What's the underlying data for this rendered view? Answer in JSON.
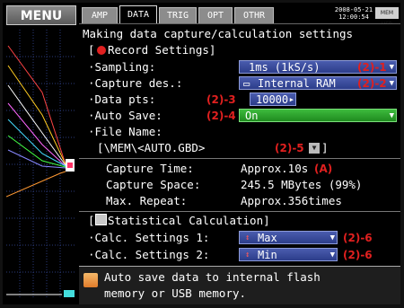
{
  "menu_button": "MENU",
  "tabs": [
    {
      "label": "AMP",
      "active": false
    },
    {
      "label": "DATA",
      "active": true
    },
    {
      "label": "TRIG",
      "active": false
    },
    {
      "label": "OPT",
      "active": false
    },
    {
      "label": "OTHR",
      "active": false
    }
  ],
  "status": {
    "date": "2008-05-21",
    "time": "12:00:54",
    "mem_badge": "MEM USB"
  },
  "heading": "Making data capture/calculation settings",
  "record_section": {
    "open_bracket": "[",
    "title": "Record Settings]",
    "items": [
      {
        "label": "·Sampling:",
        "value": "1ms (1kS/s)",
        "annotation": "(2)-1"
      },
      {
        "label": "·Capture des.:",
        "value": "Internal RAM",
        "annotation": "(2)-2"
      },
      {
        "label": "·Data pts:",
        "annotation": "(2)-3",
        "value": "10000"
      },
      {
        "label": "·Auto Save:",
        "annotation": "(2)-4",
        "value": "On"
      },
      {
        "label": "·File Name:"
      }
    ],
    "file_path": "[\\MEM\\<AUTO.GBD>",
    "file_path_annotation": "(2)-5",
    "file_path_close": "]"
  },
  "capture_info": {
    "capture_time_label": "Capture Time:",
    "capture_time_value": "Approx.10s",
    "capture_time_annotation": "(A)",
    "capture_space_label": "Capture Space:",
    "capture_space_value": "245.5 MBytes (99%)",
    "max_repeat_label": "Max. Repeat:",
    "max_repeat_value": "Approx.356times"
  },
  "stat_section": {
    "open_bracket": "[",
    "title": "Statistical Calculation]",
    "items": [
      {
        "label": "·Calc. Settings 1:",
        "value": "Max",
        "annotation": "(2)-6"
      },
      {
        "label": "·Calc. Settings 2:",
        "value": "Min",
        "annotation": "(2)-6"
      }
    ]
  },
  "help": {
    "line1": "Auto save data to internal flash",
    "line2": "memory or USB memory."
  },
  "colors": {
    "annotation": "#e0201f",
    "field_blue": "#34479c",
    "field_green": "#2ea52e",
    "record_dot": "#e02020"
  },
  "icons": [
    "record-dot-icon",
    "calculator-icon",
    "dropdown-arrow-icon",
    "spin-arrow-icon",
    "help-icon"
  ]
}
